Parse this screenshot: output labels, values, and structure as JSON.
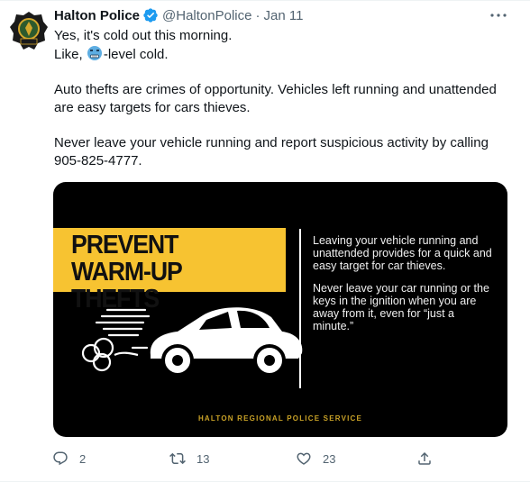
{
  "tweet": {
    "author_name": "Halton Police",
    "handle": "@HaltonPolice",
    "separator": "·",
    "date": "Jan 11",
    "line1": "Yes, it's cold out this morning.",
    "line2_after_emoji": "-level cold.",
    "line2_before_emoji": "Like, ",
    "emoji_icon": "cold-face-emoji-icon",
    "para2": "Auto thefts are crimes of opportunity. Vehicles left running and unattended are easy targets for cars thieves.",
    "para3": "Never leave your vehicle running and report suspicious activity by calling 905-825-4777."
  },
  "media": {
    "headline_line1": "PREVENT",
    "headline_line2": "WARM-UP THEFTS",
    "side_para1": "Leaving your vehicle running and unattended provides for a quick and easy target for car thieves.",
    "side_para2": "Never leave your car running or the keys in the ignition when you are away from it, even for “just a minute.”",
    "footer": "HALTON REGIONAL POLICE SERVICE",
    "colors": {
      "background": "#000000",
      "banner": "#f7c331",
      "footer": "#c9a227"
    }
  },
  "actions": {
    "reply_count": "2",
    "retweet_count": "13",
    "like_count": "23"
  },
  "colors": {
    "verified": "#1d9bf0",
    "secondary_text": "#536471"
  }
}
